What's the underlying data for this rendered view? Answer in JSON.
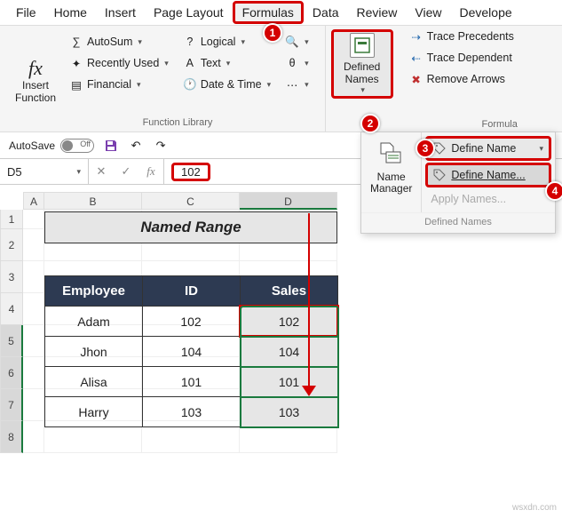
{
  "tabs": {
    "file": "File",
    "home": "Home",
    "insert": "Insert",
    "page_layout": "Page Layout",
    "formulas": "Formulas",
    "data": "Data",
    "review": "Review",
    "view": "View",
    "developer": "Develope"
  },
  "ribbon": {
    "insert_function": "Insert\nFunction",
    "fx": "fx",
    "autosum": "AutoSum",
    "recently_used": "Recently Used",
    "financial": "Financial",
    "logical": "Logical",
    "text": "Text",
    "date_time": "Date & Time",
    "defined_names": "Defined\nNames",
    "trace_precedents": "Trace Precedents",
    "trace_dependent": "Trace Dependent",
    "remove_arrows": "Remove Arrows",
    "group_function_library": "Function Library",
    "group_formula": "Formula"
  },
  "flyout": {
    "name_manager": "Name\nManager",
    "define_name": "Define Name",
    "define_name_dlg": "Define Name...",
    "apply_names": "Apply Names...",
    "group_label": "Defined Names"
  },
  "qat": {
    "autosave": "AutoSave",
    "off": "Off"
  },
  "formula_bar": {
    "name_box": "D5",
    "value": "102"
  },
  "columns": {
    "A": "A",
    "B": "B",
    "C": "C",
    "D": "D"
  },
  "rows": {
    "r1": "1",
    "r2": "2",
    "r3": "3",
    "r4": "4",
    "r5": "5",
    "r6": "6",
    "r7": "7",
    "r8": "8"
  },
  "sheet": {
    "title": "Named Range",
    "headers": {
      "employee": "Employee",
      "id": "ID",
      "sales": "Sales"
    },
    "data": [
      {
        "employee": "Adam",
        "id": "102",
        "sales": "102"
      },
      {
        "employee": "Jhon",
        "id": "104",
        "sales": "104"
      },
      {
        "employee": "Alisa",
        "id": "101",
        "sales": "101"
      },
      {
        "employee": "Harry",
        "id": "103",
        "sales": "103"
      }
    ]
  },
  "badges": {
    "b1": "1",
    "b2": "2",
    "b3": "3",
    "b4": "4"
  },
  "watermark": "wsxdn.com"
}
